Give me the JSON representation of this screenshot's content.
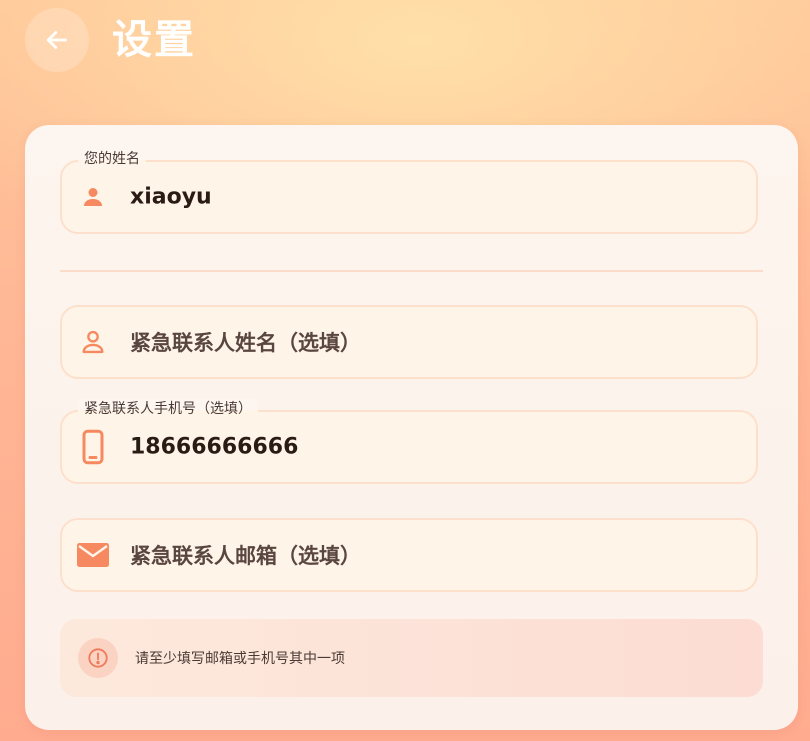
{
  "header": {
    "title": "设置"
  },
  "form": {
    "name": {
      "label": "您的姓名",
      "value": "xiaoyu",
      "icon": "person-icon"
    },
    "emergency_name": {
      "placeholder": "紧急联系人姓名（选填）",
      "icon": "person-outline-icon"
    },
    "emergency_phone": {
      "label": "紧急联系人手机号（选填）",
      "value": "18666666666",
      "icon": "phone-icon"
    },
    "emergency_email": {
      "placeholder": "紧急联系人邮箱（选填）",
      "icon": "mail-icon"
    },
    "hint": {
      "text": "请至少填写邮箱或手机号其中一项",
      "icon": "info-icon"
    }
  },
  "colors": {
    "accent": "#f6895f",
    "card_bg": "#fdf5ef",
    "field_bg": "#fff4e8",
    "field_border": "#fde0cc",
    "title": "#ffffff"
  }
}
